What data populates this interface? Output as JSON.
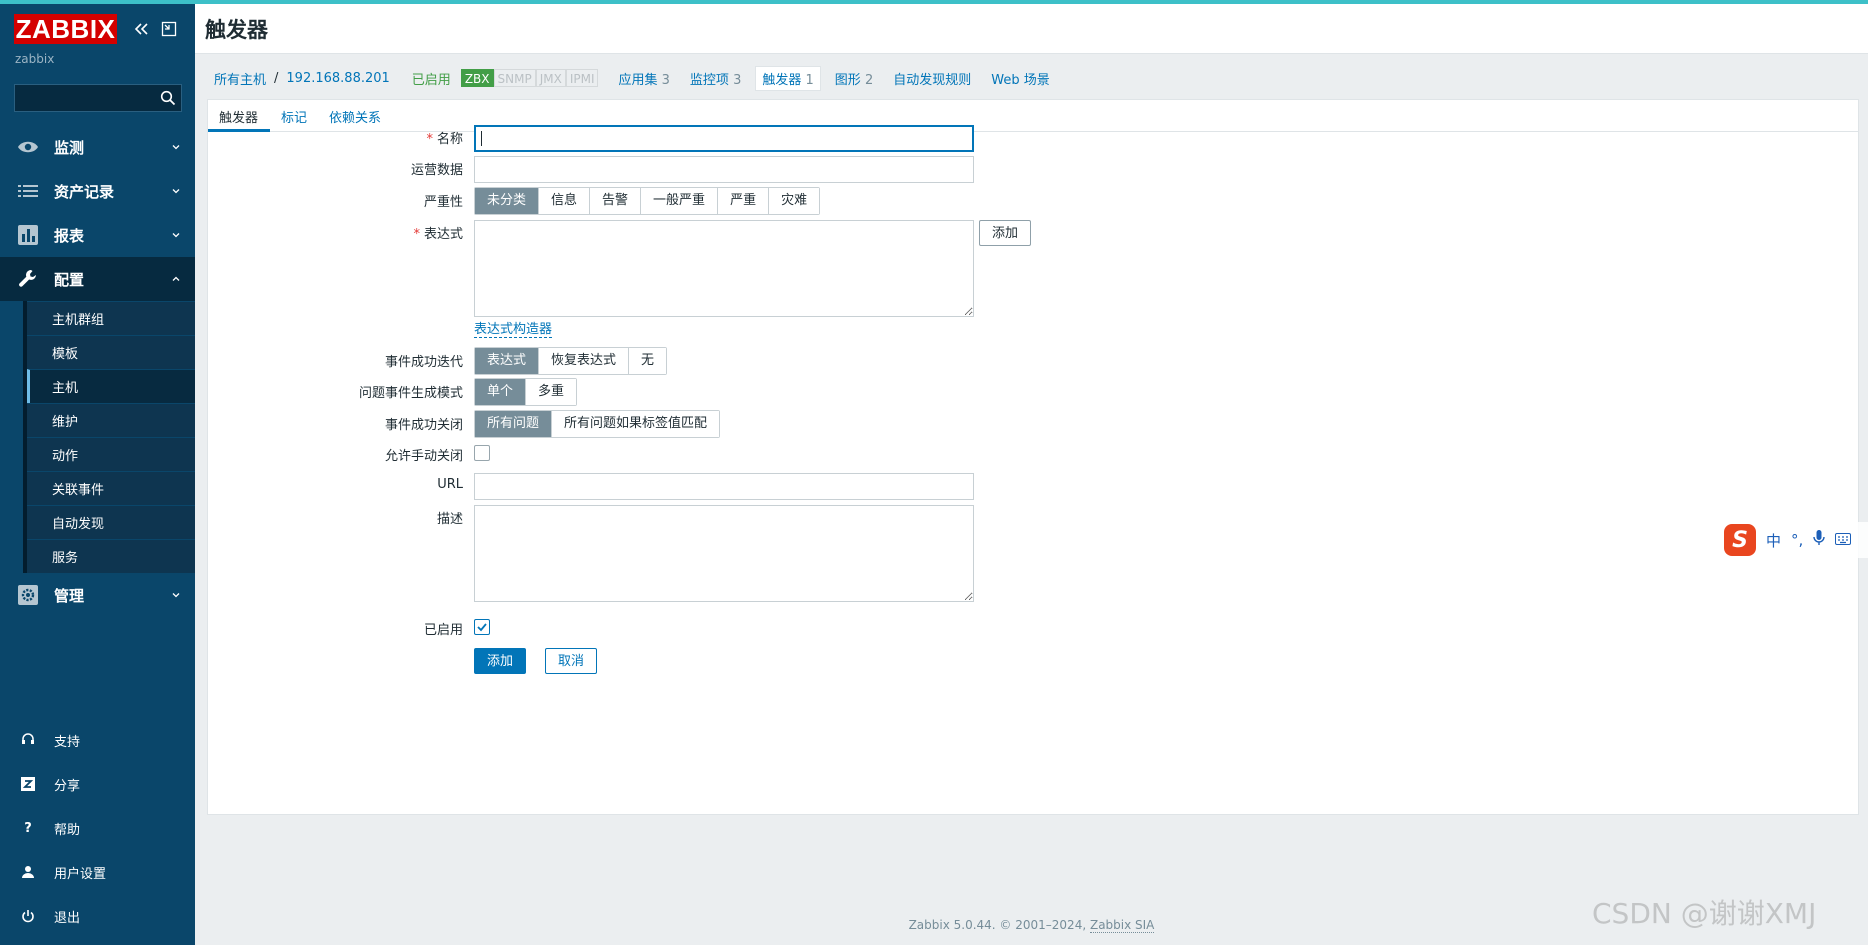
{
  "brand": {
    "logo_text": "ZABBIX",
    "server_name": "zabbix"
  },
  "sidebar": {
    "search_placeholder": "",
    "menu": [
      {
        "label": "监测",
        "icon": "eye-icon"
      },
      {
        "label": "资产记录",
        "icon": "list-icon"
      },
      {
        "label": "报表",
        "icon": "bar-chart-icon"
      },
      {
        "label": "配置",
        "icon": "wrench-icon"
      },
      {
        "label": "管理",
        "icon": "gear-icon"
      }
    ],
    "config_submenu": [
      "主机群组",
      "模板",
      "主机",
      "维护",
      "动作",
      "关联事件",
      "自动发现",
      "服务"
    ],
    "bottom": [
      {
        "label": "支持",
        "icon": "headset-icon"
      },
      {
        "label": "分享",
        "icon": "share-z-icon"
      },
      {
        "label": "帮助",
        "icon": "help-icon"
      },
      {
        "label": "用户设置",
        "icon": "user-icon"
      },
      {
        "label": "退出",
        "icon": "power-icon"
      }
    ]
  },
  "header": {
    "title": "触发器"
  },
  "hostnav": {
    "all_hosts": "所有主机",
    "host": "192.168.88.201",
    "enabled": "已启用",
    "availability": [
      "ZBX",
      "SNMP",
      "JMX",
      "IPMI"
    ],
    "links": [
      {
        "label": "应用集",
        "count": "3"
      },
      {
        "label": "监控项",
        "count": "3"
      },
      {
        "label": "触发器",
        "count": "1"
      },
      {
        "label": "图形",
        "count": "2"
      },
      {
        "label": "自动发现规则",
        "count": ""
      },
      {
        "label": "Web 场景",
        "count": ""
      }
    ]
  },
  "tabs": [
    "触发器",
    "标记",
    "依赖关系"
  ],
  "form": {
    "name_label": "名称",
    "name_value": "",
    "opdata_label": "运营数据",
    "opdata_value": "",
    "severity_label": "严重性",
    "severity_options": [
      "未分类",
      "信息",
      "告警",
      "一般严重",
      "严重",
      "灾难"
    ],
    "severity_selected": "未分类",
    "expression_label": "表达式",
    "expression_value": "",
    "add_button": "添加",
    "expression_builder": "表达式构造器",
    "ok_event_label": "事件成功迭代",
    "ok_event_options": [
      "表达式",
      "恢复表达式",
      "无"
    ],
    "ok_event_selected": "表达式",
    "problem_mode_label": "问题事件生成模式",
    "problem_mode_options": [
      "单个",
      "多重"
    ],
    "problem_mode_selected": "单个",
    "ok_close_label": "事件成功关闭",
    "ok_close_options": [
      "所有问题",
      "所有问题如果标签值匹配"
    ],
    "ok_close_selected": "所有问题",
    "manual_close_label": "允许手动关闭",
    "manual_close_checked": false,
    "url_label": "URL",
    "url_value": "",
    "description_label": "描述",
    "description_value": "",
    "enabled_label": "已启用",
    "enabled_checked": true,
    "submit": "添加",
    "cancel": "取消"
  },
  "footer": {
    "text": "Zabbix 5.0.44. © 2001–2024, ",
    "company": "Zabbix SIA"
  },
  "overlay": {
    "ime_logo": "S",
    "ime_mode": "中",
    "ime_punct": "°,",
    "watermark": "CSDN @谢谢XMJ"
  },
  "colors": {
    "accent": "#0275b8",
    "sidebar": "#0a466a",
    "logo": "#d40000",
    "enabled": "#429e47",
    "selected_segment": "#768d99"
  }
}
